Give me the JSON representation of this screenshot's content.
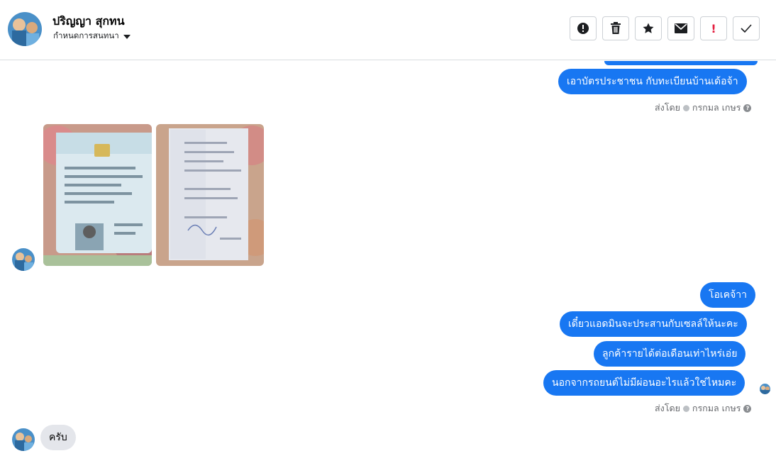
{
  "header": {
    "contact_name": "ปริญญา สุกทน",
    "subtitle": "กำหนดการสนทนา",
    "toolbar": {
      "buttons": [
        {
          "icon": "alert-circle-icon",
          "glyph": ""
        },
        {
          "icon": "trash-icon",
          "glyph": ""
        },
        {
          "icon": "star-icon",
          "glyph": ""
        },
        {
          "icon": "envelope-icon",
          "glyph": ""
        },
        {
          "icon": "exclamation-icon",
          "glyph": "!"
        },
        {
          "icon": "checkmark-icon",
          "glyph": ""
        }
      ]
    }
  },
  "messages": {
    "out_top": "เอาบัตรประชาชน กับทะเบียนบ้านเด้อจ้า",
    "sent_by_1": {
      "prefix": "ส่งโดย",
      "name": "กรกมล เกษร",
      "help": "?"
    },
    "out_1": "โอเคจ้าา",
    "out_2": "เดี๋ยวแอดมินจะประสานกับเซลล์ให้นะคะ",
    "out_3": "ลูกค้ารายได้ต่อเดือนเท่าไหร่เอ่ย",
    "out_4": "นอกจากรถยนต์ไม่มีผ่อนอะไรแล้วใช่ไหมคะ",
    "sent_by_2": {
      "prefix": "ส่งโดย",
      "name": "กรกมล เกษร",
      "help": "?"
    },
    "in_1": "ครับ"
  },
  "colors": {
    "outgoing_bubble": "#1877f2",
    "incoming_bubble": "#e4e6eb",
    "alert_red": "#e41e3f"
  }
}
